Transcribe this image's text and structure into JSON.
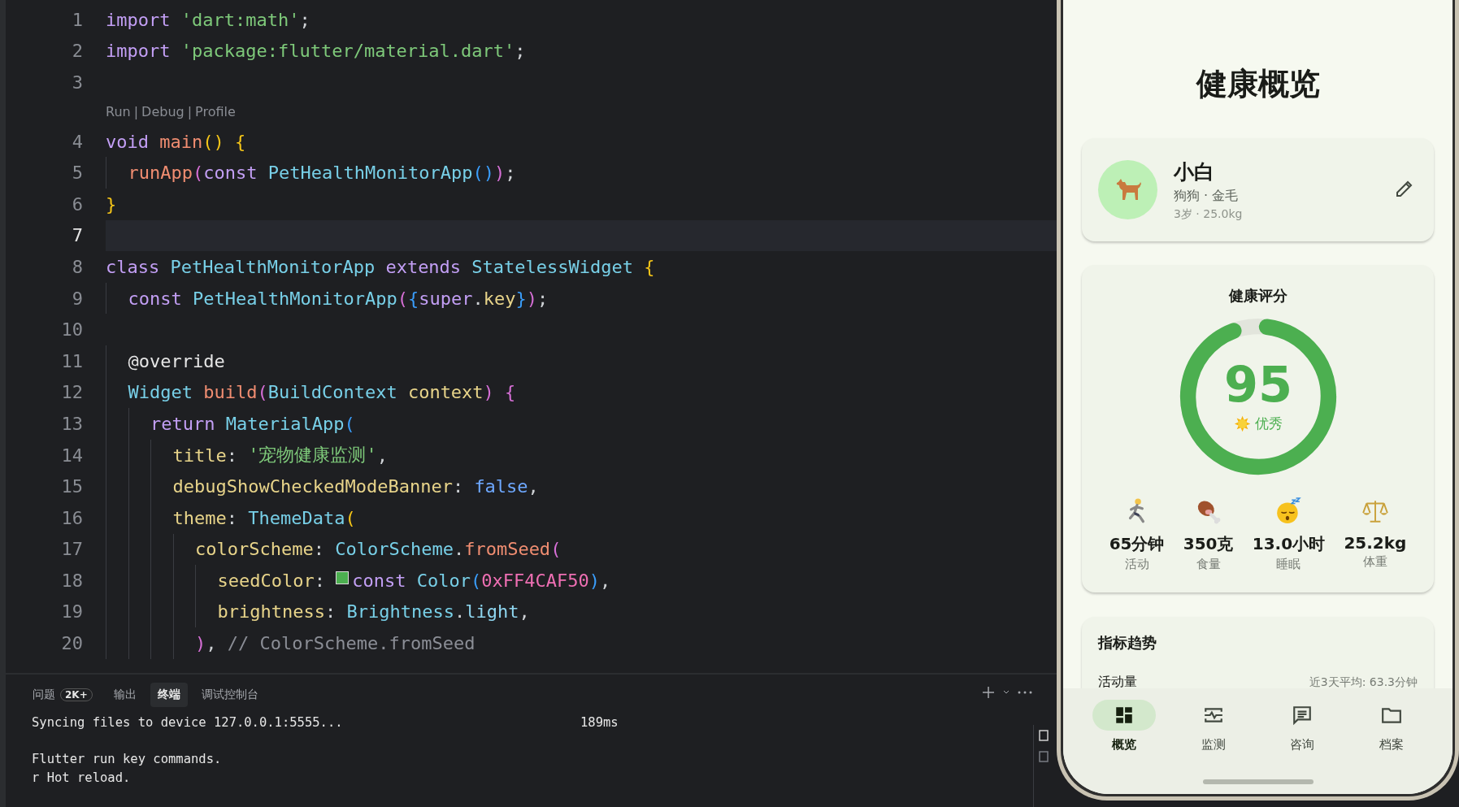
{
  "editor": {
    "lines": [
      {
        "number": "1",
        "current": false,
        "tokens": [
          {
            "kind": "kw",
            "t": "import "
          },
          {
            "kind": "str",
            "t": "'dart:math'"
          },
          {
            "kind": "punct",
            "t": ";"
          }
        ]
      },
      {
        "number": "2",
        "current": false,
        "tokens": [
          {
            "kind": "kw",
            "t": "import "
          },
          {
            "kind": "str",
            "t": "'package:flutter/material.dart'"
          },
          {
            "kind": "punct",
            "t": ";"
          }
        ]
      },
      {
        "number": "3",
        "current": false
      },
      {
        "number": "4",
        "current": false,
        "codelens": [
          "Run",
          "Debug",
          "Profile"
        ],
        "codelens_separator": "|",
        "tokens": [
          {
            "kind": "kw",
            "t": "void "
          },
          {
            "kind": "fn",
            "t": "main"
          },
          {
            "kind": "b1",
            "t": "() {"
          }
        ]
      },
      {
        "number": "5",
        "current": false,
        "tokens": [
          {
            "kind": "fn",
            "t": "  runApp"
          },
          {
            "kind": "b2",
            "t": "("
          },
          {
            "kind": "kw",
            "t": "const "
          },
          {
            "kind": "type",
            "t": "PetHealthMonitorApp"
          },
          {
            "kind": "b3",
            "t": "()"
          },
          {
            "kind": "b2",
            "t": ")"
          },
          {
            "kind": "punct",
            "t": ";"
          }
        ]
      },
      {
        "number": "6",
        "current": false,
        "tokens": [
          {
            "kind": "b1",
            "t": "}"
          }
        ]
      },
      {
        "number": "7",
        "current": true
      },
      {
        "number": "8",
        "current": false,
        "tokens": [
          {
            "kind": "kw",
            "t": "class "
          },
          {
            "kind": "type",
            "t": "PetHealthMonitorApp "
          },
          {
            "kind": "kw",
            "t": "extends "
          },
          {
            "kind": "type",
            "t": "StatelessWidget "
          },
          {
            "kind": "b1",
            "t": "{"
          }
        ]
      },
      {
        "number": "9",
        "current": false,
        "tokens": [
          {
            "kind": "kw",
            "t": "  const "
          },
          {
            "kind": "type",
            "t": "PetHealthMonitorApp"
          },
          {
            "kind": "b2",
            "t": "("
          },
          {
            "kind": "b3",
            "t": "{"
          },
          {
            "kind": "kw",
            "t": "super"
          },
          {
            "kind": "punct",
            "t": "."
          },
          {
            "kind": "prop",
            "t": "key"
          },
          {
            "kind": "b3",
            "t": "}"
          },
          {
            "kind": "b2",
            "t": ")"
          },
          {
            "kind": "punct",
            "t": ";"
          }
        ]
      },
      {
        "number": "10",
        "current": false
      },
      {
        "number": "11",
        "current": false,
        "tokens": [
          {
            "kind": "annot",
            "t": "  @override"
          }
        ]
      },
      {
        "number": "12",
        "current": false,
        "tokens": [
          {
            "kind": "type",
            "t": "  Widget "
          },
          {
            "kind": "fn",
            "t": "build"
          },
          {
            "kind": "b2",
            "t": "("
          },
          {
            "kind": "type",
            "t": "BuildContext "
          },
          {
            "kind": "prop",
            "t": "context"
          },
          {
            "kind": "b2",
            "t": ") {"
          }
        ]
      },
      {
        "number": "13",
        "current": false,
        "tokens": [
          {
            "kind": "kw",
            "t": "    return "
          },
          {
            "kind": "type",
            "t": "MaterialApp"
          },
          {
            "kind": "b3",
            "t": "("
          }
        ]
      },
      {
        "number": "14",
        "current": false,
        "tokens": [
          {
            "kind": "prop",
            "t": "      title"
          },
          {
            "kind": "punct",
            "t": ": "
          },
          {
            "kind": "str",
            "t": "'宠物健康监测'"
          },
          {
            "kind": "punct",
            "t": ","
          }
        ]
      },
      {
        "number": "15",
        "current": false,
        "tokens": [
          {
            "kind": "prop",
            "t": "      debugShowCheckedModeBanner"
          },
          {
            "kind": "punct",
            "t": ": "
          },
          {
            "kind": "bool",
            "t": "false"
          },
          {
            "kind": "punct",
            "t": ","
          }
        ]
      },
      {
        "number": "16",
        "current": false,
        "tokens": [
          {
            "kind": "prop",
            "t": "      theme"
          },
          {
            "kind": "punct",
            "t": ": "
          },
          {
            "kind": "type",
            "t": "ThemeData"
          },
          {
            "kind": "b1",
            "t": "("
          }
        ]
      },
      {
        "number": "17",
        "current": false,
        "tokens": [
          {
            "kind": "prop",
            "t": "        colorScheme"
          },
          {
            "kind": "punct",
            "t": ": "
          },
          {
            "kind": "type",
            "t": "ColorScheme"
          },
          {
            "kind": "punct",
            "t": "."
          },
          {
            "kind": "fn",
            "t": "fromSeed"
          },
          {
            "kind": "b2",
            "t": "("
          }
        ]
      },
      {
        "number": "18",
        "current": false,
        "tokens": [
          {
            "kind": "prop",
            "t": "          seedColor"
          },
          {
            "kind": "punct",
            "t": ": "
          },
          {
            "kind": "swatch",
            "color": "#4caf50"
          },
          {
            "kind": "kw",
            "t": "const "
          },
          {
            "kind": "type",
            "t": "Color"
          },
          {
            "kind": "b3",
            "t": "("
          },
          {
            "kind": "num",
            "t": "0xFF4CAF50"
          },
          {
            "kind": "b3",
            "t": ")"
          },
          {
            "kind": "punct",
            "t": ","
          }
        ]
      },
      {
        "number": "19",
        "current": false,
        "tokens": [
          {
            "kind": "prop",
            "t": "          brightness"
          },
          {
            "kind": "punct",
            "t": ": "
          },
          {
            "kind": "type",
            "t": "Brightness"
          },
          {
            "kind": "punct",
            "t": "."
          },
          {
            "kind": "enum",
            "t": "light"
          },
          {
            "kind": "punct",
            "t": ","
          }
        ]
      },
      {
        "number": "20",
        "current": false,
        "tokens": [
          {
            "kind": "b2",
            "t": "        )"
          },
          {
            "kind": "punct",
            "t": ", "
          },
          {
            "kind": "comment",
            "t": "// ColorScheme.fromSeed"
          }
        ]
      }
    ]
  },
  "panel": {
    "tabs": [
      {
        "label": "问题",
        "badge": "2K+",
        "selected": false
      },
      {
        "label": "输出",
        "selected": false
      },
      {
        "label": "终端",
        "selected": true
      },
      {
        "label": "调试控制台",
        "selected": false
      }
    ],
    "terminal_blocks": [
      {
        "lines": [
          {
            "text": "Syncing files to device 127.0.0.1:5555...",
            "time": "189ms"
          }
        ]
      },
      {
        "lines": [
          {
            "text": "Flutter run key commands."
          },
          {
            "text": "r Hot reload."
          }
        ]
      }
    ]
  },
  "phone": {
    "title": "健康概览",
    "pet": {
      "name": "小白",
      "breed": "狗狗 · 金毛",
      "details": "3岁 · 25.0kg"
    },
    "score": {
      "title": "健康评分",
      "value": "95",
      "level": 0.95,
      "rating": "优秀",
      "stats": [
        {
          "kind": "runner",
          "value": "65分钟",
          "label": "活动"
        },
        {
          "kind": "meat",
          "value": "350克",
          "label": "食量"
        },
        {
          "kind": "sleepy",
          "value": "13.0小时",
          "label": "睡眠"
        },
        {
          "kind": "scale",
          "value": "25.2kg",
          "label": "体重"
        }
      ]
    },
    "trends": {
      "title": "指标趋势",
      "metric": "活动量",
      "average": "近3天平均: 63.3分钟"
    },
    "nav": [
      {
        "kind": "grid",
        "label": "概览",
        "selected": true
      },
      {
        "kind": "monitor",
        "label": "监测",
        "selected": false
      },
      {
        "kind": "chat",
        "label": "咨询",
        "selected": false
      },
      {
        "kind": "folder",
        "label": "档案",
        "selected": false
      }
    ]
  }
}
